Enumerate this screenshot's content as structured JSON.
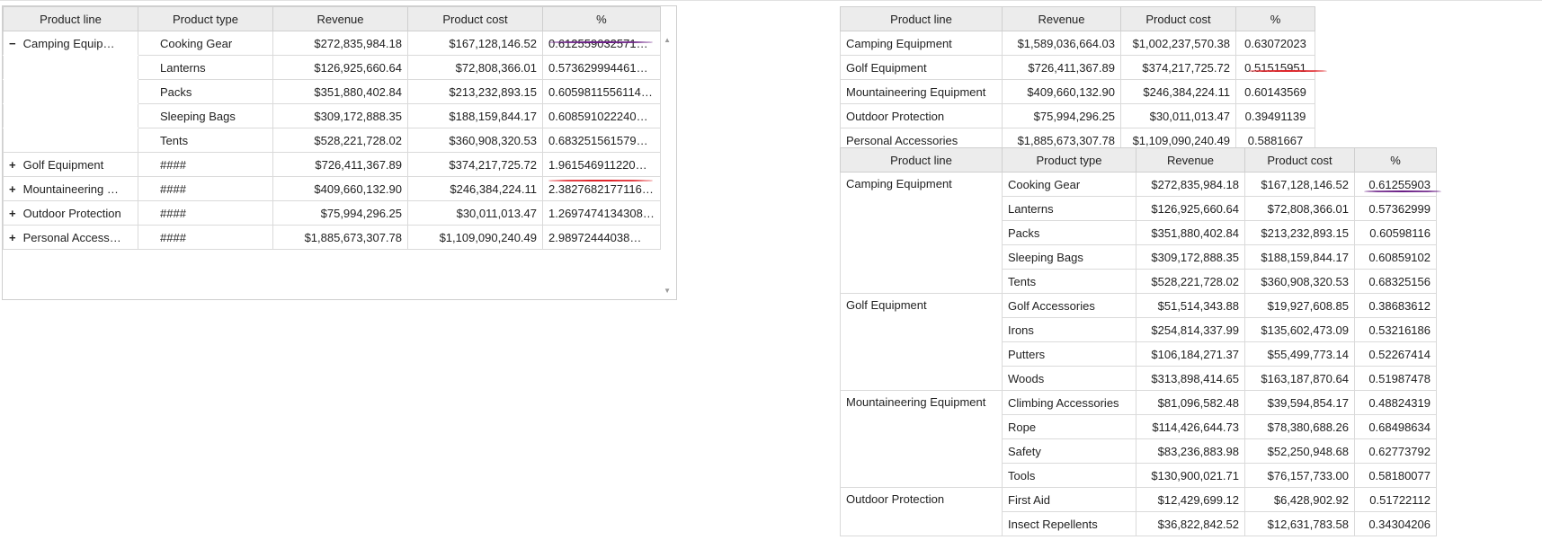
{
  "left_table": {
    "headers": [
      "Product line",
      "Product type",
      "Revenue",
      "Product cost",
      "%"
    ],
    "rows": [
      {
        "toggle": "−",
        "line": "Camping Equip…",
        "type": "Cooking Gear",
        "revenue": "$272,835,984.18",
        "cost": "$167,128,146.52",
        "pct": "0.612559032571…"
      },
      {
        "toggle": "",
        "line": "",
        "type": "Lanterns",
        "revenue": "$126,925,660.64",
        "cost": "$72,808,366.01",
        "pct": "0.573629994461…"
      },
      {
        "toggle": "",
        "line": "",
        "type": "Packs",
        "revenue": "$351,880,402.84",
        "cost": "$213,232,893.15",
        "pct": "0.6059811556114…"
      },
      {
        "toggle": "",
        "line": "",
        "type": "Sleeping Bags",
        "revenue": "$309,172,888.35",
        "cost": "$188,159,844.17",
        "pct": "0.608591022240…"
      },
      {
        "toggle": "",
        "line": "",
        "type": "Tents",
        "revenue": "$528,221,728.02",
        "cost": "$360,908,320.53",
        "pct": "0.683251561579…"
      },
      {
        "toggle": "+",
        "line": "Golf Equipment",
        "type": "####",
        "revenue": "$726,411,367.89",
        "cost": "$374,217,725.72",
        "pct": "1.961546911220…"
      },
      {
        "toggle": "+",
        "line": "Mountaineering …",
        "type": "####",
        "revenue": "$409,660,132.90",
        "cost": "$246,384,224.11",
        "pct": "2.3827682177116…"
      },
      {
        "toggle": "+",
        "line": "Outdoor Protection",
        "type": "####",
        "revenue": "$75,994,296.25",
        "cost": "$30,011,013.47",
        "pct": "1.2697474134308…"
      },
      {
        "toggle": "+",
        "line": "Personal Access…",
        "type": "####",
        "revenue": "$1,885,673,307.78",
        "cost": "$1,109,090,240.49",
        "pct": "2.98972444038…"
      }
    ],
    "scroll_up": "▲",
    "scroll_down": "▼"
  },
  "right_top_table": {
    "headers": [
      "Product line",
      "Revenue",
      "Product cost",
      "%"
    ],
    "rows": [
      {
        "line": "Camping Equipment",
        "revenue": "$1,589,036,664.03",
        "cost": "$1,002,237,570.38",
        "pct": "0.63072023"
      },
      {
        "line": "Golf Equipment",
        "revenue": "$726,411,367.89",
        "cost": "$374,217,725.72",
        "pct": "0.51515951"
      },
      {
        "line": "Mountaineering Equipment",
        "revenue": "$409,660,132.90",
        "cost": "$246,384,224.11",
        "pct": "0.60143569"
      },
      {
        "line": "Outdoor Protection",
        "revenue": "$75,994,296.25",
        "cost": "$30,011,013.47",
        "pct": "0.39491139"
      },
      {
        "line": "Personal Accessories",
        "revenue": "$1,885,673,307.78",
        "cost": "$1,109,090,240.49",
        "pct": "0.5881667"
      }
    ]
  },
  "right_bottom_table": {
    "headers": [
      "Product line",
      "Product type",
      "Revenue",
      "Product cost",
      "%"
    ],
    "groups": [
      {
        "line": "Camping Equipment",
        "rows": [
          {
            "type": "Cooking Gear",
            "revenue": "$272,835,984.18",
            "cost": "$167,128,146.52",
            "pct": "0.61255903"
          },
          {
            "type": "Lanterns",
            "revenue": "$126,925,660.64",
            "cost": "$72,808,366.01",
            "pct": "0.57362999"
          },
          {
            "type": "Packs",
            "revenue": "$351,880,402.84",
            "cost": "$213,232,893.15",
            "pct": "0.60598116"
          },
          {
            "type": "Sleeping Bags",
            "revenue": "$309,172,888.35",
            "cost": "$188,159,844.17",
            "pct": "0.60859102"
          },
          {
            "type": "Tents",
            "revenue": "$528,221,728.02",
            "cost": "$360,908,320.53",
            "pct": "0.68325156"
          }
        ]
      },
      {
        "line": "Golf Equipment",
        "rows": [
          {
            "type": "Golf Accessories",
            "revenue": "$51,514,343.88",
            "cost": "$19,927,608.85",
            "pct": "0.38683612"
          },
          {
            "type": "Irons",
            "revenue": "$254,814,337.99",
            "cost": "$135,602,473.09",
            "pct": "0.53216186"
          },
          {
            "type": "Putters",
            "revenue": "$106,184,271.37",
            "cost": "$55,499,773.14",
            "pct": "0.52267414"
          },
          {
            "type": "Woods",
            "revenue": "$313,898,414.65",
            "cost": "$163,187,870.64",
            "pct": "0.51987478"
          }
        ]
      },
      {
        "line": "Mountaineering Equipment",
        "rows": [
          {
            "type": "Climbing Accessories",
            "revenue": "$81,096,582.48",
            "cost": "$39,594,854.17",
            "pct": "0.48824319"
          },
          {
            "type": "Rope",
            "revenue": "$114,426,644.73",
            "cost": "$78,380,688.26",
            "pct": "0.68498634"
          },
          {
            "type": "Safety",
            "revenue": "$83,236,883.98",
            "cost": "$52,250,948.68",
            "pct": "0.62773792"
          },
          {
            "type": "Tools",
            "revenue": "$130,900,021.71",
            "cost": "$76,157,733.00",
            "pct": "0.58180077"
          }
        ]
      },
      {
        "line": "Outdoor Protection",
        "rows": [
          {
            "type": "First Aid",
            "revenue": "$12,429,699.12",
            "cost": "$6,428,902.92",
            "pct": "0.51722112"
          },
          {
            "type": "Insect Repellents",
            "revenue": "$36,822,842.52",
            "cost": "$12,631,783.58",
            "pct": "0.34304206"
          }
        ]
      }
    ]
  },
  "colors": {
    "annotation_purple": "#6b1f86",
    "annotation_red": "#e0262b",
    "header_bg": "#ececec"
  }
}
